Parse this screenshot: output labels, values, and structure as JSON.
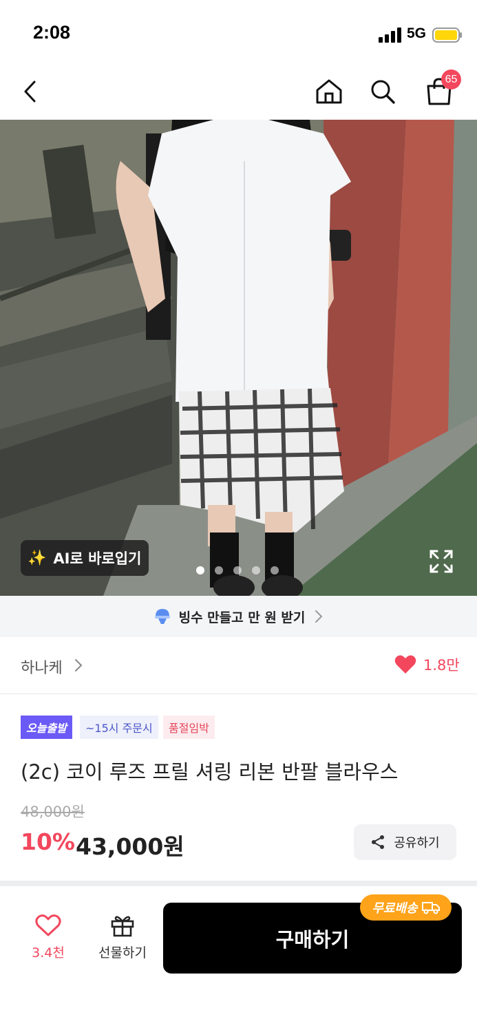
{
  "status": {
    "time": "2:08",
    "network": "5G"
  },
  "nav": {
    "cart_count": "65"
  },
  "hero": {
    "ai_button_label": "AI로 바로입기",
    "slide_count": 5,
    "active_slide": 1
  },
  "promo": {
    "text": "빙수 만들고 만 원 받기"
  },
  "shop": {
    "name": "하나케",
    "likes": "1.8만"
  },
  "product": {
    "badges": [
      "오늘출발",
      "~15시 주문시",
      "품절임박"
    ],
    "title": "(2c) 코이 루즈 프릴 셔링 리본 반팔 블라우스",
    "original_price": "48,000원",
    "discount": "10%",
    "price": "43,000원",
    "share_label": "공유하기"
  },
  "bottom_bar": {
    "wish_count": "3.4천",
    "gift_label": "선물하기",
    "buy_label": "구매하기",
    "shipping_tag": "무료배송"
  },
  "colors": {
    "accent": "#f2475d",
    "badge_purple": "#6b5af5",
    "shipping_orange": "#ffa31a"
  }
}
